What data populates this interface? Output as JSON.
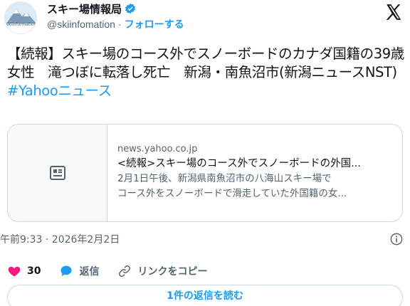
{
  "author": {
    "display_name": "スキー場情報局",
    "handle": "@skiinfomation",
    "separator": "·",
    "follow_label": "フォローする",
    "avatar_caption": "skiinformation",
    "verified": true,
    "verified_color": "#1d9bf0"
  },
  "tweet": {
    "text": "【続報】スキー場のコース外でスノーボードのカナダ国籍の39歳女性　滝つぼに転落し死亡　新潟・南魚沼市(新潟ニュースNST)",
    "hashtag": "#Yahooニュース"
  },
  "card": {
    "icon": "article-icon",
    "domain": "news.yahoo.co.jp",
    "title": "<続報>スキー場のコース外でスノーボードの外国...",
    "description_line1": "2月1日午後、新潟県南魚沼市の八海山スキー場で",
    "description_line2": "コース外をスノーボードで滑走していた外国籍の女..."
  },
  "meta": {
    "timestamp": "午前9:33 · 2026年2月2日"
  },
  "actions": {
    "like_count": "30",
    "like_color": "#f91880",
    "reply_label": "返信",
    "reply_color": "#1d9bf0",
    "copy_link_label": "リンクをコピー"
  },
  "replies_button": {
    "label": "1件の返信を読む"
  },
  "colors": {
    "accent": "#1d9bf0",
    "text": "#0f1419",
    "secondary": "#536471",
    "border": "#cfd9de"
  }
}
